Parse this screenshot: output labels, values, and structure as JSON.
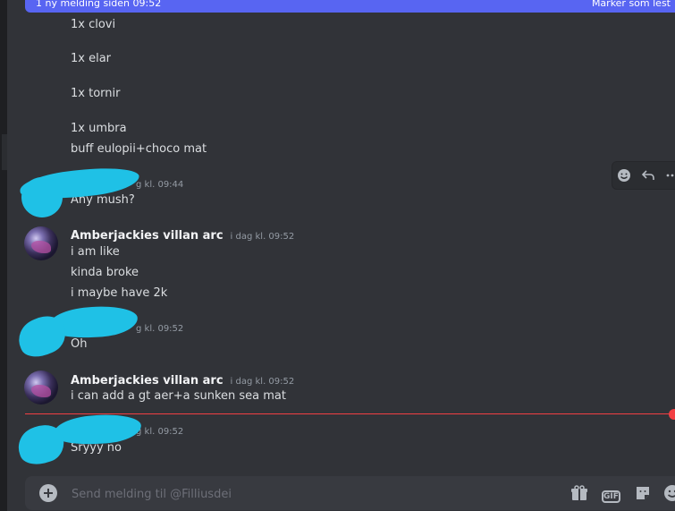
{
  "new_message_bar": {
    "left_text": "1 ny melding siden 09:52",
    "right_text": "Marker som lest"
  },
  "messages": [
    {
      "lines": [
        "1x clovi",
        "1x elar",
        "1x tornir",
        "1x umbra",
        "buff eulopii+choco mat"
      ]
    },
    {
      "username": "",
      "timestamp_partial": "g kl. 09:44",
      "lines": [
        "Any mush?"
      ]
    },
    {
      "username": "Amberjackies villan arc",
      "timestamp": "i dag kl. 09:52",
      "lines": [
        "i am like",
        "kinda broke",
        "i maybe have 2k"
      ]
    },
    {
      "username": "",
      "timestamp_partial": "g kl. 09:52",
      "lines": [
        "Oh"
      ]
    },
    {
      "username": "Amberjackies villan arc",
      "timestamp": "i dag kl. 09:52",
      "lines": [
        "i can add a gt aer+a sunken sea mat"
      ]
    },
    {
      "username": "",
      "timestamp_partial": "g kl. 09:52",
      "lines": [
        "Sryyy no"
      ]
    }
  ],
  "composer": {
    "placeholder": "Send melding til @Filliusdei",
    "icons": [
      "gift-icon",
      "gif-icon",
      "sticker-icon",
      "emoji-icon"
    ],
    "gif_label": "GIF"
  },
  "hover_toolbar": {
    "icons": [
      "add-reaction-icon",
      "reply-icon",
      "more-icon"
    ]
  },
  "colors": {
    "background": "#313338",
    "accent": "#5865f2",
    "new_divider": "#f23f43",
    "redaction": "#1fc1e6"
  }
}
